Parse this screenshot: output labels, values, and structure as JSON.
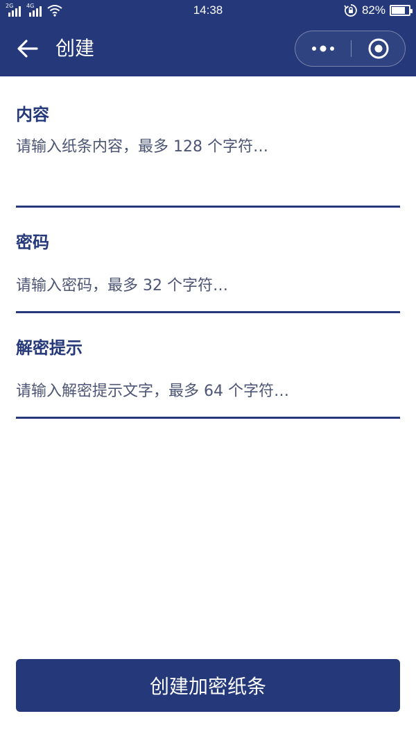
{
  "status_bar": {
    "sim1_label": "2G",
    "sim2_label": "4G",
    "time": "14:38",
    "battery_percent_text": "82%",
    "battery_level": 0.82,
    "icons": [
      "signal-icon",
      "wifi-icon",
      "rotation-lock-icon",
      "battery-icon"
    ]
  },
  "nav": {
    "title": "创建",
    "back_icon": "arrow-left-icon",
    "more_icon": "more-dots-icon",
    "close_icon": "target-circle-icon"
  },
  "form": {
    "content": {
      "label": "内容",
      "placeholder": "请输入纸条内容，最多 128 个字符…",
      "value": ""
    },
    "password": {
      "label": "密码",
      "placeholder": "请输入密码，最多 32 个字符…",
      "value": ""
    },
    "hint": {
      "label": "解密提示",
      "placeholder": "请输入解密提示文字，最多 64 个字符…",
      "value": ""
    }
  },
  "submit": {
    "label": "创建加密纸条"
  },
  "colors": {
    "primary": "#24387a",
    "background": "#ffffff",
    "placeholder": "#4d5574"
  }
}
